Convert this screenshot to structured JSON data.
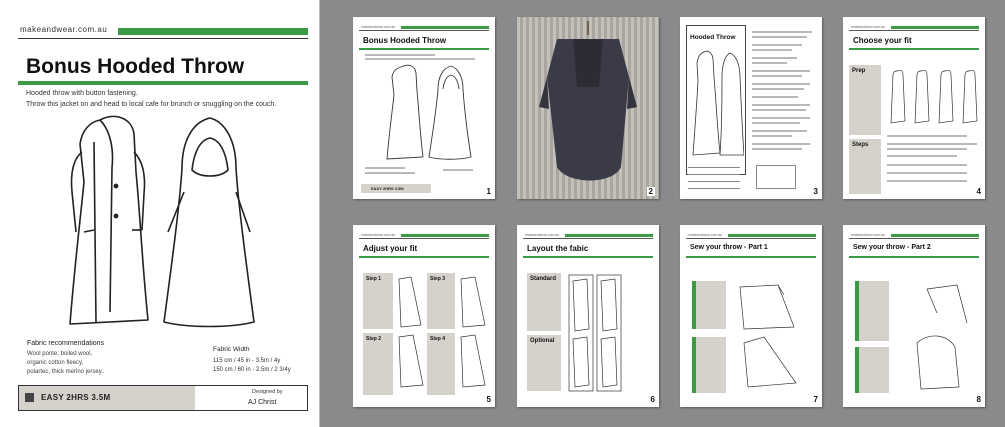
{
  "cover": {
    "url": "makeandwear.com.au",
    "title": "Bonus Hooded Throw",
    "description": [
      "Hooded throw with button fastening.",
      "Throw this jacket on and head to local cafe for brunch or snuggling on the couch."
    ],
    "fabric_heading": "Fabric recommendations",
    "fabric_lines": [
      "Wool ponte; boiled wool,",
      "organic cotton fleecy,",
      "polartec, thick merino jersey.."
    ],
    "width_heading": "Fabric Width",
    "width_lines": [
      "115 cm / 45 in - 3.5m / 4y",
      "150 cm / 60 in -  2.5m / 2 3/4y"
    ],
    "difficulty": "EASY 2HRS  3.5M",
    "designed_label": "Designed by",
    "designer": "AJ Christ"
  },
  "thumbs": [
    {
      "title": "Bonus Hooded Throw",
      "num": "1"
    },
    {
      "title": "",
      "num": "2"
    },
    {
      "title": "Hooded Throw",
      "num": "3"
    },
    {
      "title": "Choose your fit",
      "num": "4",
      "side1": "Prep",
      "side2": "Steps"
    },
    {
      "title": "Adjust your fit",
      "num": "5",
      "steps": [
        "Step 1",
        "Step 2",
        "Step 3",
        "Step 4"
      ]
    },
    {
      "title": "Layout the fabic",
      "num": "6",
      "side1": "Standard",
      "side2": "Optional"
    },
    {
      "title": "Sew your throw - Part 1",
      "num": "7"
    },
    {
      "title": "Sew your throw - Part 2",
      "num": "8"
    }
  ]
}
